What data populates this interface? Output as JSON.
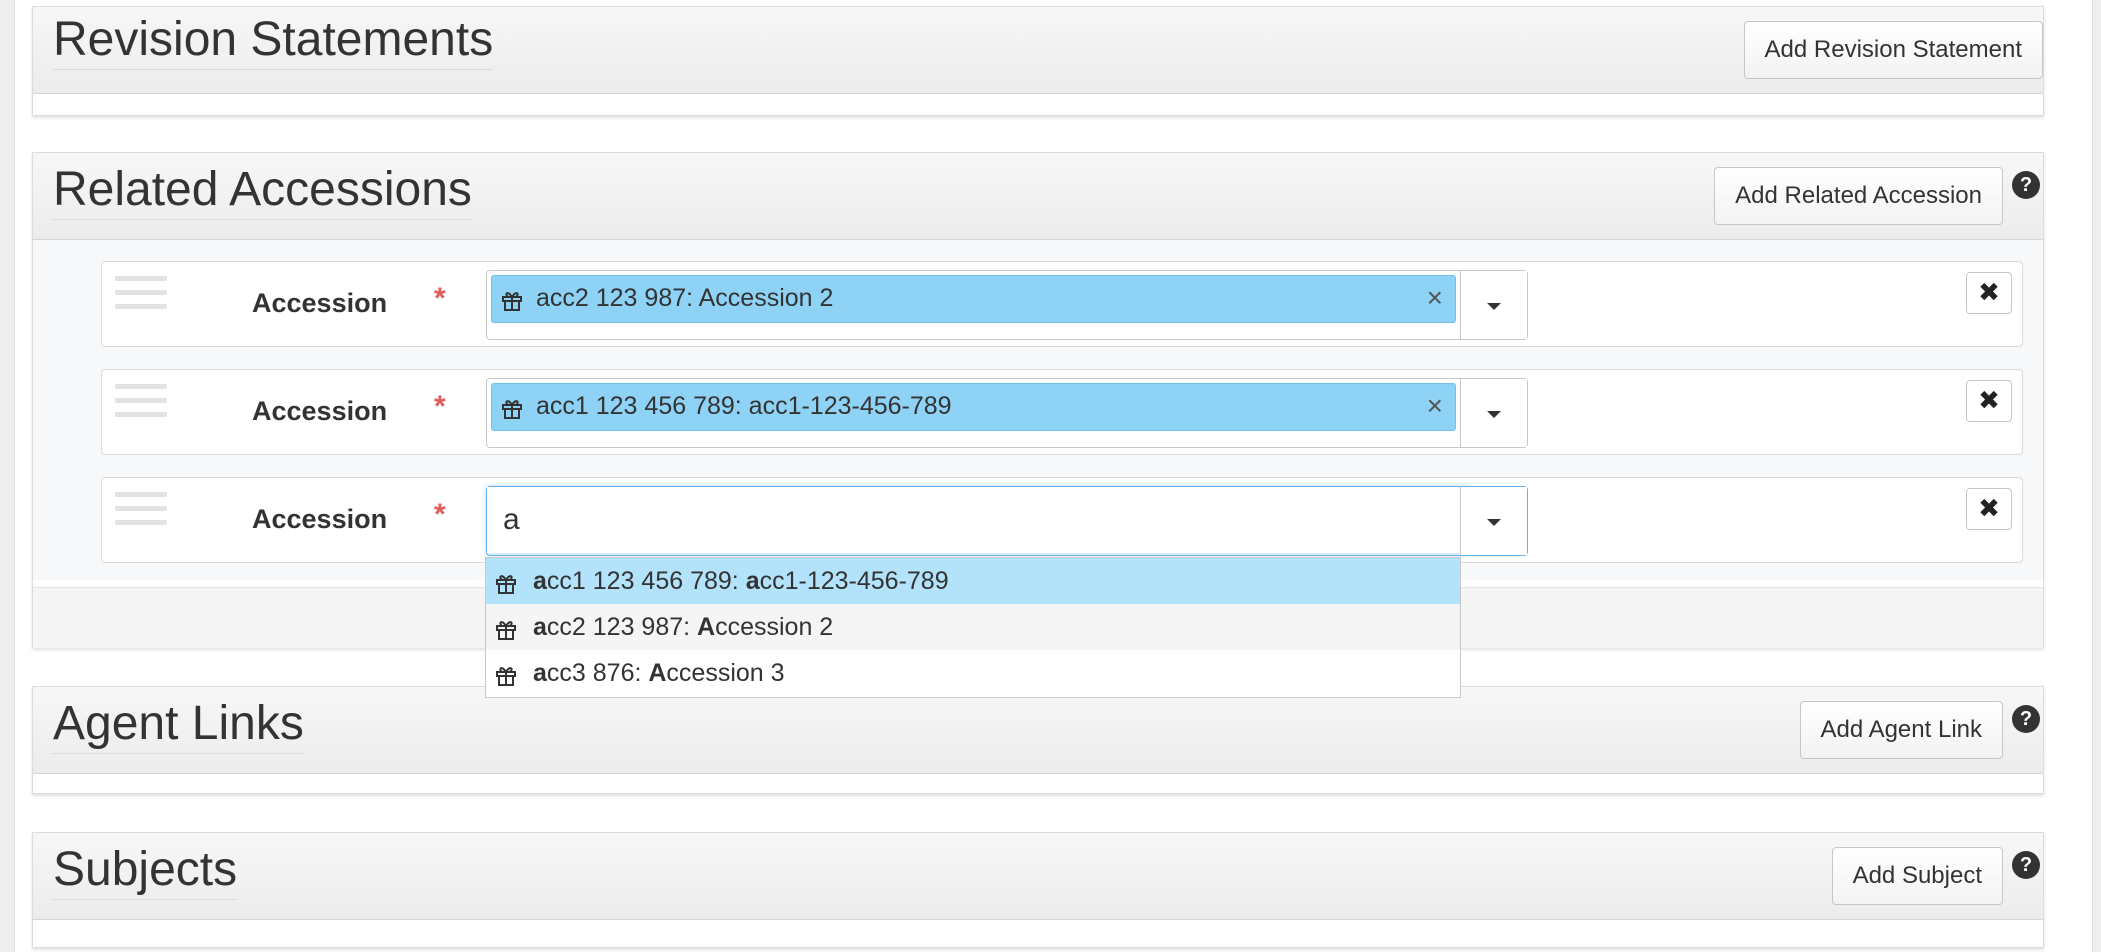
{
  "sections": {
    "revision": {
      "title": "Revision Statements",
      "add_label": "Add Revision Statement"
    },
    "related": {
      "title": "Related Accessions",
      "add_label": "Add Related Accession",
      "help": "?"
    },
    "agents": {
      "title": "Agent Links",
      "add_label": "Add Agent Link",
      "help": "?"
    },
    "subjects": {
      "title": "Subjects",
      "add_label": "Add Subject",
      "help": "?"
    }
  },
  "accession_rows": [
    {
      "label": "Accession",
      "required_mark": "*",
      "token": "acc2 123 987: Accession 2",
      "clear": "×",
      "remove": "✖"
    },
    {
      "label": "Accession",
      "required_mark": "*",
      "token": "acc1 123 456 789: acc1-123-456-789",
      "clear": "×",
      "remove": "✖"
    },
    {
      "label": "Accession",
      "required_mark": "*",
      "input_value": "a",
      "remove": "✖"
    }
  ],
  "typeahead": {
    "query": "a",
    "items": [
      {
        "text": "acc1 123 456 789: acc1-123-456-789",
        "highlighted": true
      },
      {
        "text": "acc2 123 987: Accession 2"
      },
      {
        "text": "acc3 876: Accession 3"
      }
    ]
  },
  "icons": {
    "token": "gift-icon",
    "help": "question-circle-icon",
    "remove": "close-icon",
    "dropdown": "caret-down-icon",
    "drag": "drag-handle-icon"
  },
  "colors": {
    "token_bg": "#8ed2f5",
    "highlight_bg": "#b3e3fa",
    "hover_bg": "#f5f5f5",
    "required": "#e05d5d",
    "header_bg": "#eeeeee"
  }
}
